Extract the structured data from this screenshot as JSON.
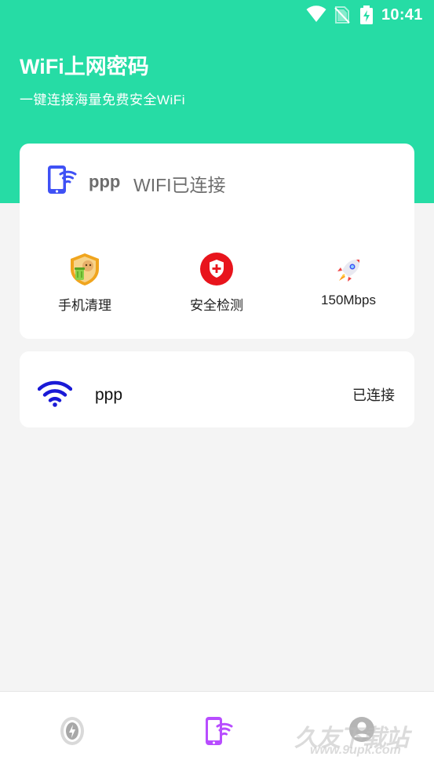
{
  "status_bar": {
    "time": "10:41"
  },
  "header": {
    "title": "WiFi上网密码",
    "subtitle": "一键连接海量免费安全WiFi"
  },
  "connection": {
    "ssid": "ppp",
    "state": "WIFI已连接"
  },
  "tools": [
    {
      "label": "手机清理",
      "icon": "cleaner-icon"
    },
    {
      "label": "安全检测",
      "icon": "shield-plus-icon"
    },
    {
      "label": "150Mbps",
      "icon": "rocket-icon"
    }
  ],
  "networks": [
    {
      "ssid": "ppp",
      "status": "已连接",
      "icon": "wifi-signal-icon"
    }
  ],
  "bottom_nav": [
    {
      "icon": "speed-shield-icon"
    },
    {
      "icon": "phone-wifi-icon",
      "active": true
    },
    {
      "icon": "profile-icon"
    }
  ],
  "colors": {
    "brand_green": "#26dca5",
    "accent_blue": "#3f51f5",
    "wifi_blue": "#1a1ad6",
    "danger_red": "#e8141c",
    "nav_active_purple": "#b84dff"
  }
}
